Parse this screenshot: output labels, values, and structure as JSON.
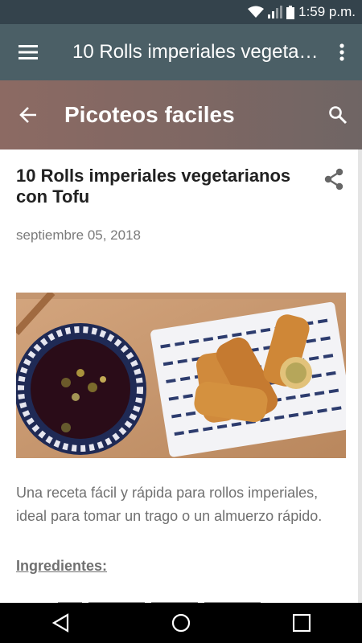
{
  "status_bar": {
    "time": "1:59 p.m.",
    "icons": [
      "wifi-icon",
      "signal-icon",
      "battery-icon"
    ]
  },
  "app_bar": {
    "title": "10 Rolls imperiales vegetarianos con Tofu",
    "icons": [
      "menu-icon",
      "more-vert-icon"
    ]
  },
  "blog_header": {
    "name": "Picoteos faciles",
    "icons": [
      "arrow-back-icon",
      "search-icon"
    ]
  },
  "post": {
    "title": "10 Rolls imperiales vegetarianos con Tofu",
    "date": "septiembre 05, 2018",
    "body": "Una receta fácil y rápida para rollos imperiales, ideal para tomar un trago o un almuerzo rápido.",
    "ingredients_heading": "Ingredientes:",
    "icons": [
      "share-icon"
    ]
  },
  "nav_bar": {
    "icons": [
      "nav-back-icon",
      "nav-home-icon",
      "nav-recents-icon"
    ]
  },
  "colors": {
    "status_bar": "#34434c",
    "app_bar": "#4b5f66",
    "blog_header": "#7f6763",
    "title_text": "#212121",
    "secondary_text": "#707070"
  }
}
